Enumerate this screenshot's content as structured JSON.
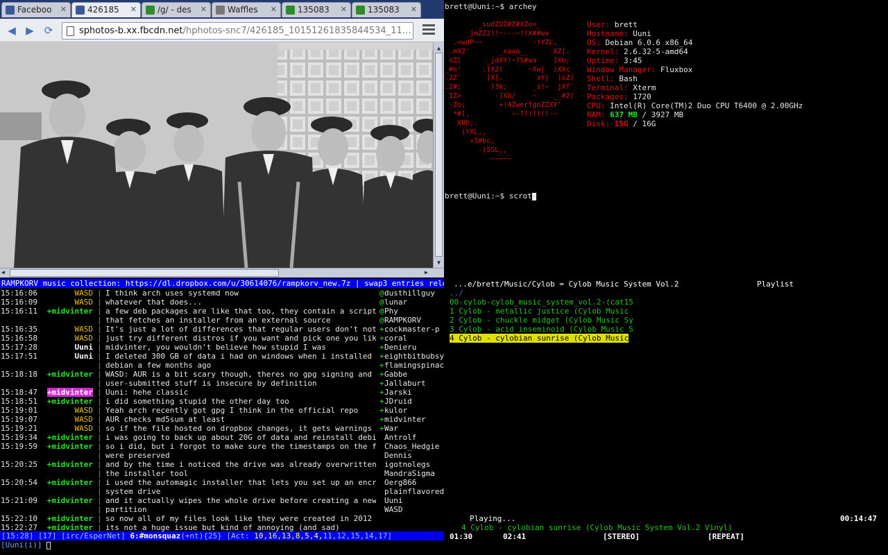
{
  "browser": {
    "tabs": [
      {
        "label": "Faceboo",
        "icon": "facebook-icon",
        "color": "#3b5998",
        "active": false
      },
      {
        "label": "426185",
        "icon": "facebook-icon",
        "color": "#3b5998",
        "active": true
      },
      {
        "label": "/g/ - des",
        "icon": "leaf-icon",
        "color": "#2d8a2d",
        "active": false
      },
      {
        "label": "Waffles",
        "icon": "folder-icon",
        "color": "#777777",
        "active": false
      },
      {
        "label": "135083",
        "icon": "clover-icon",
        "color": "#2d8a2d",
        "active": false
      },
      {
        "label": "135083",
        "icon": "clover-icon",
        "color": "#2d8a2d",
        "active": false
      }
    ],
    "url_host": "sphotos-b.xx.fbcdn.net",
    "url_path": "/hphotos-snc7/426185_10151261835844534_11…",
    "page_icon": "page-icon"
  },
  "irc": {
    "topic": "RAMPKORV music collection: https://dl.dropbox.com/u/30614076/rampkorv_new.7z | swap3 entries released: h++",
    "lines": [
      {
        "time": "15:16:06",
        "nick": "WASD",
        "type": "wasd",
        "text": "I think arch uses systemd now"
      },
      {
        "time": "15:16:09",
        "nick": "WASD",
        "type": "wasd",
        "text": "whatever that does..."
      },
      {
        "time": "15:16:11",
        "nick": "+midvinter",
        "type": "mid",
        "text": "a few deb packages are like that too, they contain a script/tool"
      },
      {
        "time": "",
        "nick": "",
        "type": "cont",
        "text": "that fetches an installer from an external source"
      },
      {
        "time": "15:16:35",
        "nick": "WASD",
        "type": "wasd",
        "text": "It's just a lot of differences that regular users don't notice,"
      },
      {
        "time": "15:16:58",
        "nick": "WASD",
        "type": "wasd",
        "text": "just try different distros if you want and pick one you like"
      },
      {
        "time": "15:17:28",
        "nick": "Uuni",
        "type": "uuni",
        "text": "midvinter, you wouldn't believe how stupid I was"
      },
      {
        "time": "15:17:51",
        "nick": "Uuni",
        "type": "uuni",
        "text": "I deleted 300 GB of data i had on windows when i installed"
      },
      {
        "time": "",
        "nick": "",
        "type": "cont",
        "text": "debian a few months ago"
      },
      {
        "time": "15:18:18",
        "nick": "+midvinter",
        "type": "mid",
        "text": "WASD: AUR is a bit scary though, theres no gpg signing and"
      },
      {
        "time": "",
        "nick": "",
        "type": "cont",
        "text": "user-submitted stuff is insecure by definition"
      },
      {
        "time": "15:18:47",
        "nick": "+midvinter",
        "type": "hl",
        "text": "Uuni: hehe classic"
      },
      {
        "time": "15:18:51",
        "nick": "+midvinter",
        "type": "mid",
        "text": "i did something stupid the other day too"
      },
      {
        "time": "15:19:01",
        "nick": "WASD",
        "type": "wasd",
        "text": "Yeah arch recently got gpg I think in the official repo"
      },
      {
        "time": "15:19:07",
        "nick": "WASD",
        "type": "wasd",
        "text": "AUR checks md5sum at least"
      },
      {
        "time": "15:19:21",
        "nick": "WASD",
        "type": "wasd",
        "text": "so if the file hosted on dropbox changes, it gets warnings"
      },
      {
        "time": "15:19:34",
        "nick": "+midvinter",
        "type": "mid",
        "text": "i was going to back up about 20G of data and reinstall debian"
      },
      {
        "time": "15:19:59",
        "nick": "+midvinter",
        "type": "mid",
        "text": "so i did, but i forgot to make sure the timestamps on the files"
      },
      {
        "time": "",
        "nick": "",
        "type": "cont",
        "text": "were preserved"
      },
      {
        "time": "15:20:25",
        "nick": "+midvinter",
        "type": "mid",
        "text": "and by the time i noticed the drive was already overwritten by"
      },
      {
        "time": "",
        "nick": "",
        "type": "cont",
        "text": "the installer tool"
      },
      {
        "time": "15:20:54",
        "nick": "+midvinter",
        "type": "mid",
        "text": "i used the automagic installer that lets you set up an encrypted"
      },
      {
        "time": "",
        "nick": "",
        "type": "cont",
        "text": "system drive"
      },
      {
        "time": "15:21:09",
        "nick": "+midvinter",
        "type": "mid",
        "text": "and it actually wipes the whole drive before creating a new"
      },
      {
        "time": "",
        "nick": "",
        "type": "cont",
        "text": "partition"
      },
      {
        "time": "15:22:10",
        "nick": "+midvinter",
        "type": "mid",
        "text": "so now all of my files look like they were created in 2012"
      },
      {
        "time": "15:22:27",
        "nick": "+midvinter",
        "type": "mid",
        "text": "its not a huge issue but kind of annoying (and sad)"
      }
    ],
    "nicks": [
      {
        "prefix": "@",
        "name": "dusthillguy"
      },
      {
        "prefix": "@",
        "name": "lunar"
      },
      {
        "prefix": "@",
        "name": "Phy"
      },
      {
        "prefix": "@",
        "name": "RAMPKORV"
      },
      {
        "prefix": "+",
        "name": "cockmaster-p"
      },
      {
        "prefix": "+",
        "name": "coral"
      },
      {
        "prefix": "+",
        "name": "Denieru"
      },
      {
        "prefix": "+",
        "name": "eightbitbubsy"
      },
      {
        "prefix": "+",
        "name": "flamingspinach"
      },
      {
        "prefix": "+",
        "name": "Gabbe"
      },
      {
        "prefix": "+",
        "name": "Jallaburt"
      },
      {
        "prefix": "+",
        "name": "Jarski"
      },
      {
        "prefix": "+",
        "name": "JDruid"
      },
      {
        "prefix": "+",
        "name": "kulor"
      },
      {
        "prefix": "+",
        "name": "midvinter"
      },
      {
        "prefix": "+",
        "name": "War"
      },
      {
        "prefix": "",
        "name": "Antrolf"
      },
      {
        "prefix": "",
        "name": "Chaos_Hedgie"
      },
      {
        "prefix": "",
        "name": "Dennis"
      },
      {
        "prefix": "",
        "name": "igotnolegs"
      },
      {
        "prefix": "",
        "name": "MandraSigma"
      },
      {
        "prefix": "",
        "name": "Oerg866"
      },
      {
        "prefix": "",
        "name": "plainflavored"
      },
      {
        "prefix": "",
        "name": "Uuni"
      },
      {
        "prefix": "",
        "name": "WASD"
      }
    ],
    "status": {
      "time": "[15:28]",
      "window": "[17]",
      "network": "[irc/EsperNet]",
      "channel": "6:#monsquaz",
      "modes": "(+nt){25}",
      "act_label": "[Act:",
      "act_hot": "10,16,13,8,5,4,",
      "act_rest": "11,12,15,14,17]"
    },
    "input_prompt": "[Uuni(i)]"
  },
  "terminal": {
    "prompt1": "brett@Uuni:~$ archey",
    "prompt2": "brett@Uuni:~$ scrot",
    "info": [
      {
        "key": "User:",
        "val": "brett"
      },
      {
        "key": "Hostname:",
        "val": "Uuni"
      },
      {
        "key": "OS:",
        "val": "Debian 6.0.6 x86_64"
      },
      {
        "key": "Kernel:",
        "val": "2.6.32-5-amd64"
      },
      {
        "key": "Uptime:",
        "val": "3:45"
      },
      {
        "key": "Window Manager:",
        "val": "Fluxbox"
      },
      {
        "key": "Shell:",
        "val": "Bash"
      },
      {
        "key": "Terminal:",
        "val": "Xterm"
      },
      {
        "key": "Packages:",
        "val": "1720"
      },
      {
        "key": "CPU:",
        "val": "Intel(R) Core(TM)2 Duo CPU T6400 @ 2.00GHz"
      }
    ],
    "ram": {
      "key": "RAM:",
      "used": "637 MB",
      "rest": "/ 3927 MB"
    },
    "disk": {
      "key": "Disk:",
      "used": "15G",
      "rest": "/ 16G"
    },
    "logo": "        _sudZUZ#Z#XZo=_\n     _jmZZ2!!~---~!!X##wx\n  .<wdP~~            -!YZL,\n .mX2'       _xaaa__      XZ[.\n oZ[      _jdXY!~?S#wa    ]Xb;\n_#e'     .]X2(      ~Xw|  )XXc\n.2Z`      ]X[.        xY|  ]oZ(\n.2#;       )3k;      _s!~  jXf`\n 1Z>        -]Xb/    ~    __#2(\n -Zo;        +!4ZwerfgnZZXY'\n  *#[,          ~-?!!!!!!-~\n   XUb;.\n    )YXL,,\n      +3#bc,\n        -)SSL,,\n           ~~~~~"
  },
  "music": {
    "header_path": "...e/brett/Music/Cylob = Cylob Music System Vol.2",
    "header_right": "Playlist",
    "parent": "../",
    "items": [
      "00-cylob-cylob_music_system_vol.2-(cat15",
      "1 Cylob - metallic justice (Cylob Music",
      "2 Cylob - chuckle midget (Cylob Music Sy",
      "3 Cylob - acid inseminoid (Cylob Music S",
      "4 Cylob - cylobian sunrise (Cylob Music"
    ],
    "selected_index": 4,
    "status_label": "Playing...",
    "total_time": "00:14:47",
    "now_playing": "4 Cylob - cylobian sunrise (Cylob Music System Vol.2 Vinyl)",
    "elapsed": "01:30",
    "duration": "02:41",
    "flag1": "[STEREO]",
    "flag2": "[REPEAT]"
  }
}
